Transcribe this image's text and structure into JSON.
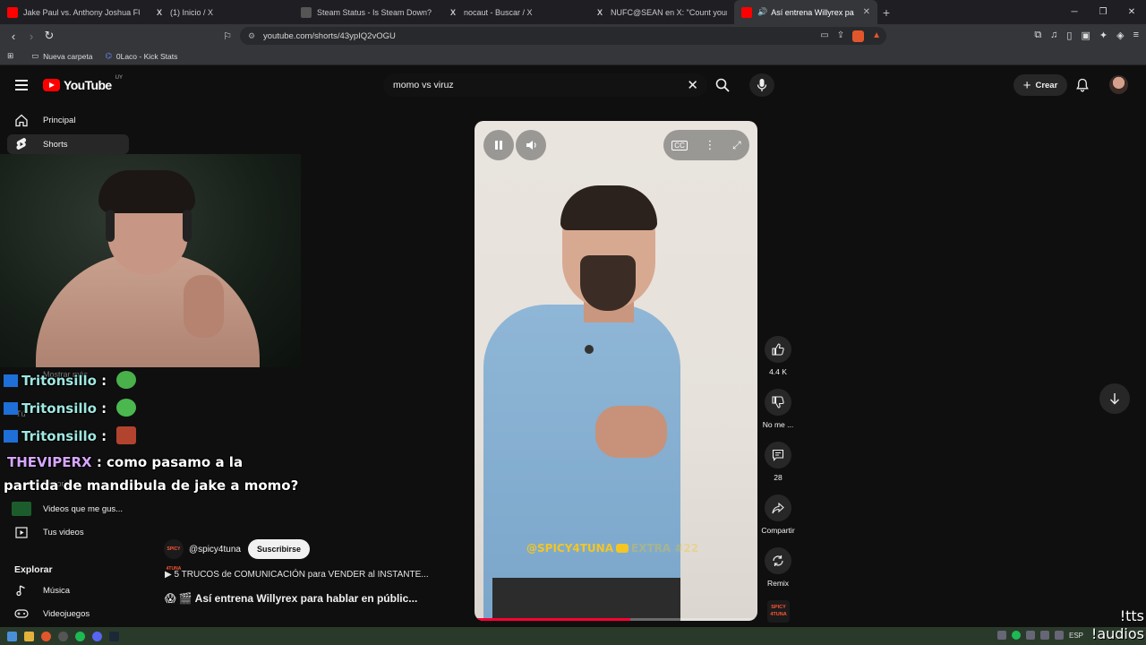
{
  "browser": {
    "tabs": [
      {
        "title": "Jake Paul vs. Anthony Joshua FULL H",
        "icon": "youtube-icon",
        "active": false
      },
      {
        "title": "(1) Inicio / X",
        "icon": "x-icon",
        "active": false
      },
      {
        "title": "Steam Status - Is Steam Down?",
        "icon": "steam-status-icon",
        "active": false
      },
      {
        "title": "nocaut - Buscar / X",
        "icon": "x-icon",
        "active": false
      },
      {
        "title": "NUFC@SEAN en X: \"Count yourself l",
        "icon": "x-icon",
        "active": false
      },
      {
        "title": "Así entrena Willyrex pa",
        "icon": "youtube-icon",
        "active": true
      }
    ],
    "url": "youtube.com/shorts/43ypIQ2vOGU",
    "brave_badge": "1",
    "bookmarks": [
      {
        "label": "Nueva carpeta",
        "icon": "folder-icon"
      },
      {
        "label": "0Laco - Kick Stats",
        "icon": "kick-icon"
      }
    ]
  },
  "youtube": {
    "logo_text": "YouTube",
    "country_code": "UY",
    "search_value": "momo vs viruz",
    "create_label": "Crear",
    "sidebar": {
      "items": [
        {
          "label": "Principal",
          "icon": "home-icon"
        },
        {
          "label": "Shorts",
          "icon": "shorts-icon"
        }
      ],
      "lower_items": [
        {
          "label": "Videos que me gus...",
          "icon": "like-icon"
        },
        {
          "label": "Tus videos",
          "icon": "video-icon"
        }
      ],
      "explore_heading": "Explorar",
      "explore_items": [
        {
          "label": "Música",
          "icon": "music-icon"
        },
        {
          "label": "Videojuegos",
          "icon": "gamepad-icon"
        }
      ],
      "faint_text": [
        "Mostrar más",
        "Tú",
        "Historial"
      ]
    },
    "short": {
      "watermark_handle": "@SPICY4TUNA",
      "watermark_extra": "EXTRA #22",
      "progress": 0.55,
      "actions": [
        {
          "label": "4.4 K",
          "icon": "thumbs-up-icon"
        },
        {
          "label": "No me ...",
          "icon": "thumbs-down-icon"
        },
        {
          "label": "28",
          "icon": "comment-icon"
        },
        {
          "label": "Compartir",
          "icon": "share-icon"
        },
        {
          "label": "Remix",
          "icon": "remix-icon"
        }
      ],
      "channel_thumb_text": "SPICY 4TUNA",
      "channel_handle": "@spicy4tuna",
      "subscribe_label": "Suscribirse",
      "related_text": "5 TRUCOS de COMUNICACIÓN para VENDER al INSTANTE...",
      "title": "😱 🎬 Así entrena Willyrex para hablar en públic..."
    }
  },
  "stream_overlay": {
    "chat": [
      {
        "user": "Tritonsillo",
        "message": ":"
      },
      {
        "user": "Tritonsillo",
        "message": ":"
      },
      {
        "user": "Tritonsillo",
        "message": ":"
      },
      {
        "user": "THEVIPERX",
        "message": ": como pasamo a la"
      },
      {
        "user": "",
        "message": "partida de mandibula de jake a momo?"
      }
    ],
    "tts_lines": [
      "!tts",
      "!audios"
    ]
  },
  "taskbar": {
    "language": "ESP"
  },
  "colors": {
    "youtube_red": "#ff0000",
    "background": "#0f0f0f",
    "chat_name": "#9ee7e0",
    "viper_name": "#d7a6ff"
  }
}
